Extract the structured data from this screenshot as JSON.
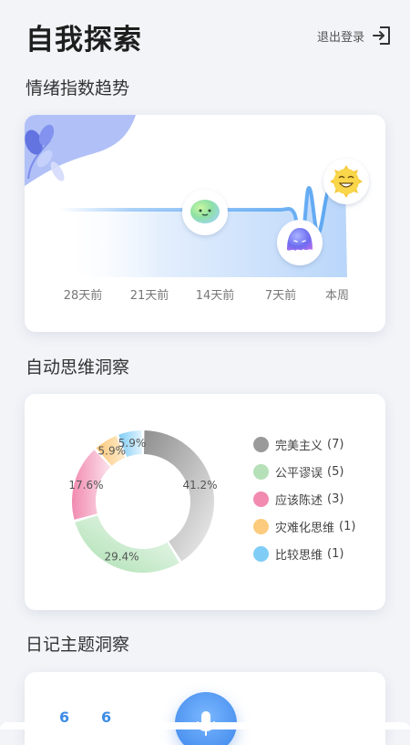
{
  "header": {
    "title": "自我探索",
    "logout_label": "退出登录"
  },
  "sections": {
    "mood_trend": "情绪指数趋势",
    "auto_thoughts": "自动思维洞察",
    "diary_topics": "日记主题洞察"
  },
  "chart_data": [
    {
      "type": "area",
      "title": "情绪指数趋势",
      "categories": [
        "28天前",
        "21天前",
        "14天前",
        "7天前",
        "本周"
      ],
      "mood_markers": [
        {
          "category": "14天前",
          "mood": "calm-green-face"
        },
        {
          "category": "7天前",
          "mood": "sad-purple-face"
        },
        {
          "category": "本周",
          "mood": "happy-sun-face"
        }
      ],
      "colors": {
        "line": "#5aa6f2",
        "area": "#bcd8fa"
      }
    },
    {
      "type": "pie",
      "title": "自动思维洞察",
      "slices": [
        {
          "name": "完美主义",
          "count": 7,
          "percent_label": "41.2%",
          "color": "#9a9a9a"
        },
        {
          "name": "公平谬误",
          "count": 5,
          "percent_label": "29.4%",
          "color": "#b5e0b8"
        },
        {
          "name": "应该陈述",
          "count": 3,
          "percent_label": "17.6%",
          "color": "#f28ab0"
        },
        {
          "name": "灾难化思维",
          "count": 1,
          "percent_label": "5.9%",
          "color": "#fccb7d"
        },
        {
          "name": "比较思维",
          "count": 1,
          "percent_label": "5.9%",
          "color": "#7fcdf7"
        }
      ]
    }
  ],
  "diary_stats": [
    "6",
    "6"
  ],
  "icons": {
    "logout": "logout-arrow-icon",
    "mic": "microphone-icon"
  }
}
